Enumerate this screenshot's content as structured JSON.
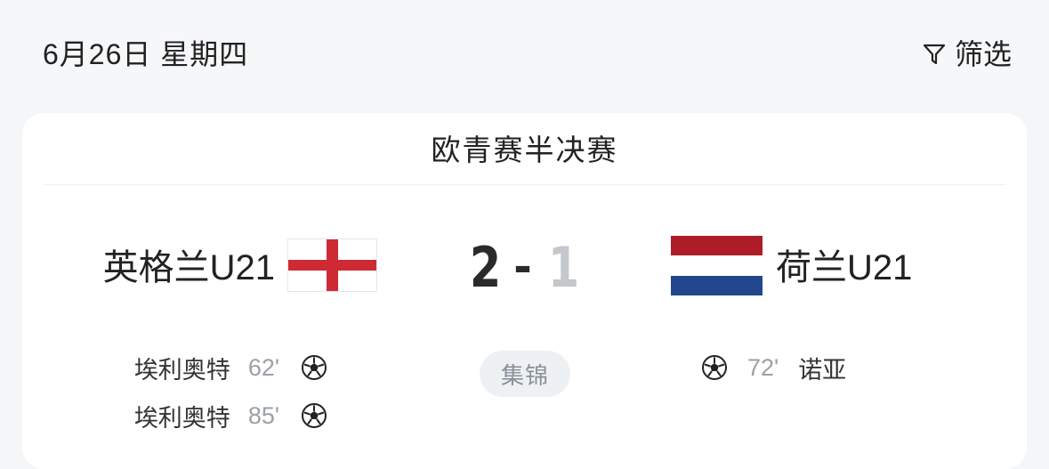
{
  "header": {
    "date": "6月26日 星期四",
    "filter_label": "筛选",
    "filter_icon": "funnel-icon"
  },
  "match": {
    "competition": "欧青赛半决赛",
    "home_team": "英格兰U21",
    "away_team": "荷兰U21",
    "home_flag": "england-flag",
    "away_flag": "netherlands-flag",
    "home_score": "2",
    "separator": "-",
    "away_score": "1",
    "highlight_label": "集锦",
    "home_goals": [
      {
        "player": "埃利奥特",
        "minute": "62'",
        "icon": "soccer-ball-icon"
      },
      {
        "player": "埃利奥特",
        "minute": "85'",
        "icon": "soccer-ball-icon"
      }
    ],
    "away_goals": [
      {
        "player": "诺亚",
        "minute": "72'",
        "icon": "soccer-ball-icon"
      }
    ]
  },
  "colors": {
    "england_red": "#ce2a34",
    "netherlands_red": "#ae1c28",
    "netherlands_blue": "#21468b",
    "score_muted": "#c4c7cc"
  }
}
